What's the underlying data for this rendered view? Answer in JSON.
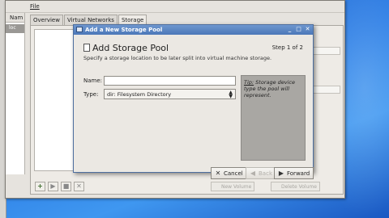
{
  "main_window": {
    "menu": {
      "file": "File"
    },
    "left_column_header": "Nam",
    "left_row_label": "loc",
    "tabs": [
      {
        "label": "Overview"
      },
      {
        "label": "Virtual Networks"
      },
      {
        "label": "Storage"
      }
    ],
    "bottom_buttons": {
      "add": "+",
      "start": "▶",
      "stop": "■",
      "delete": "✕"
    },
    "volume_buttons": {
      "new": "New Volume",
      "delete": "Delete Volume"
    }
  },
  "dialog": {
    "window_title": "Add a New Storage Pool",
    "controls": {
      "minimize": "_",
      "maximize": "□",
      "close": "✕"
    },
    "heading": "Add Storage Pool",
    "step": "Step 1 of 2",
    "subtitle": "Specify a storage location to be later split into virtual machine storage.",
    "name_label": "Name:",
    "name_value": "",
    "type_label": "Type:",
    "type_value": "dir: Filesystem Directory",
    "tip_prefix": "Tip:",
    "tip_text": "Storage device type the pool will represent.",
    "buttons": {
      "cancel": "Cancel",
      "back": "Back",
      "forward": "Forward"
    }
  },
  "colors": {
    "desktop": "#2d7fe6",
    "titlebar": "#4a77b8",
    "tip_panel": "#a9a7a3"
  }
}
